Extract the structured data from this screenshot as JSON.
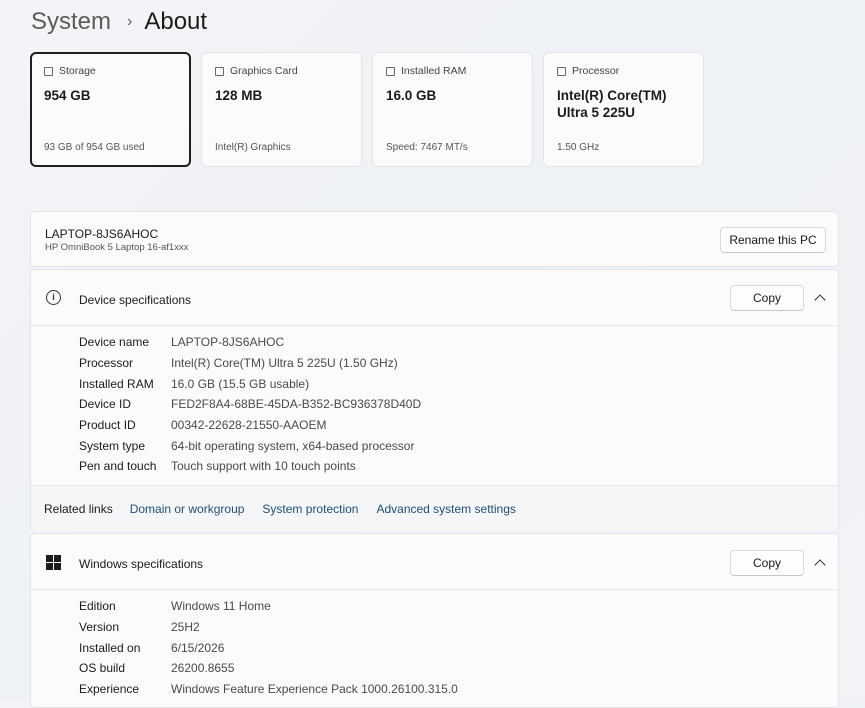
{
  "breadcrumb": {
    "parent": "System",
    "current": "About"
  },
  "cards": [
    {
      "label": "Storage",
      "value": "954 GB",
      "sub": "93 GB of 954 GB used",
      "icon": "storage-icon"
    },
    {
      "label": "Graphics Card",
      "value": "128 MB",
      "sub": "Intel(R) Graphics",
      "icon": "graphics-card-icon"
    },
    {
      "label": "Installed RAM",
      "value": "16.0 GB",
      "sub": "Speed: 7467 MT/s",
      "icon": "ram-icon"
    },
    {
      "label": "Processor",
      "value": "Intel(R) Core(TM) Ultra 5 225U",
      "sub": "1.50 GHz",
      "icon": "processor-icon"
    }
  ],
  "pc": {
    "name": "LAPTOP-8JS6AHOC",
    "model": "HP OmniBook 5 Laptop 16-af1xxx",
    "rename_label": "Rename this PC"
  },
  "device_specs": {
    "title": "Device specifications",
    "copy_label": "Copy",
    "rows": [
      {
        "label": "Device name",
        "value": "LAPTOP-8JS6AHOC"
      },
      {
        "label": "Processor",
        "value": "Intel(R) Core(TM) Ultra 5 225U (1.50 GHz)"
      },
      {
        "label": "Installed RAM",
        "value": "16.0 GB (15.5 GB usable)"
      },
      {
        "label": "Device ID",
        "value": "FED2F8A4-68BE-45DA-B352-BC936378D40D"
      },
      {
        "label": "Product ID",
        "value": "00342-22628-21550-AAOEM"
      },
      {
        "label": "System type",
        "value": "64-bit operating system, x64-based processor"
      },
      {
        "label": "Pen and touch",
        "value": "Touch support with 10 touch points"
      }
    ]
  },
  "related_links": {
    "label": "Related links",
    "links": [
      "Domain or workgroup",
      "System protection",
      "Advanced system settings"
    ]
  },
  "windows_specs": {
    "title": "Windows specifications",
    "copy_label": "Copy",
    "rows": [
      {
        "label": "Edition",
        "value": "Windows 11 Home"
      },
      {
        "label": "Version",
        "value": "25H2"
      },
      {
        "label": "Installed on",
        "value": "6/15/2026"
      },
      {
        "label": "OS build",
        "value": "26200.8655"
      },
      {
        "label": "Experience",
        "value": "Windows Feature Experience Pack 1000.26100.315.0"
      }
    ]
  }
}
